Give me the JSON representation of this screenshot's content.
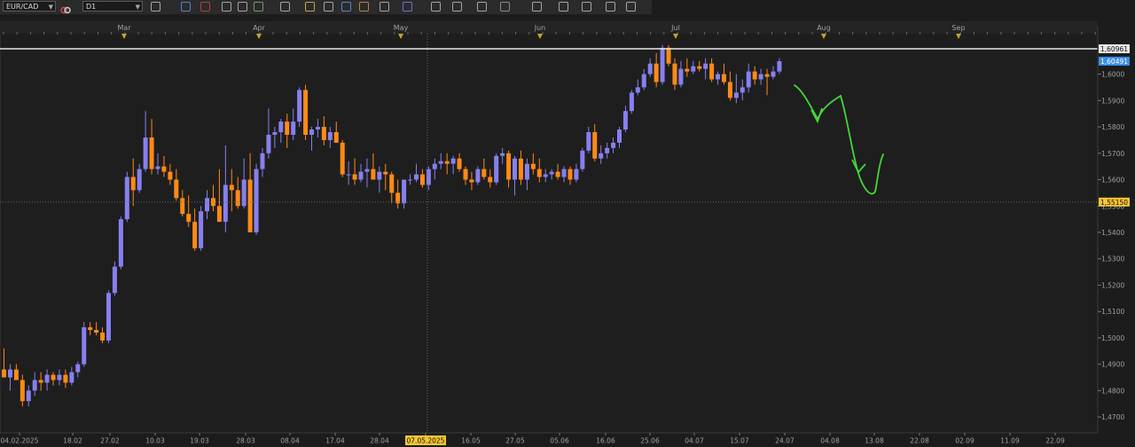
{
  "toolbar": {
    "symbol": "EUR/CAD",
    "timeframe": "D1",
    "icons": [
      "link-icon",
      "chart-type-icon",
      "bar-chart-icon",
      "candle-chart-icon",
      "zoom-in-icon",
      "zoom-out-icon",
      "crosshair-icon",
      "cursor-icon",
      "text-icon",
      "note-icon",
      "palette-icon",
      "globe-icon",
      "pencil-icon",
      "indicator-icon",
      "line-tool-icon",
      "fibonacci-icon",
      "shapes-icon",
      "arrow-icon",
      "sphere-icon",
      "gear-icon",
      "eraser-icon",
      "expand-icon"
    ]
  },
  "colors": {
    "background": "#1c1c1c",
    "up_candle": "#8680f0",
    "down_candle": "#ff8a16",
    "axis_text": "#a0a0a0",
    "highlight_tag": "#f7c531",
    "annotation": "#43d63a",
    "price_line": "#e8e8e8"
  },
  "chart_data": {
    "type": "candlestick",
    "symbol": "EUR/CAD",
    "timeframe": "D1",
    "y_ticks": [
      "1,6000",
      "1,5900",
      "1,5800",
      "1,5700",
      "1,5600",
      "1,5500",
      "1,5400",
      "1,5300",
      "1,5200",
      "1,5100",
      "1,5000",
      "1,4900",
      "1,4800",
      "1,4700"
    ],
    "x_ticks": [
      "04.02.2025",
      "18.02",
      "27.02",
      "10.03",
      "19.03",
      "28.03",
      "08.04",
      "17.04",
      "28.04",
      "07.05.2025",
      "16.05",
      "27.05",
      "05.06",
      "16.06",
      "25.06",
      "04.07",
      "15.07",
      "24.07",
      "04.08",
      "13.08",
      "22.08",
      "02.09",
      "11.09",
      "22.09"
    ],
    "month_labels": [
      "Mar",
      "Apr",
      "May",
      "Jun",
      "Jul",
      "Aug",
      "Sep"
    ],
    "highlighted_date": "07.05.2025",
    "price_labels": {
      "horizontal_line": "1,60961",
      "current": "1,60491",
      "crosshair": "1,55150"
    },
    "ylim": [
      1.464,
      1.616
    ],
    "candles": [
      [
        1.488,
        1.496,
        1.485,
        1.485
      ],
      [
        1.485,
        1.49,
        1.48,
        1.488
      ],
      [
        1.488,
        1.49,
        1.484,
        1.484
      ],
      [
        1.484,
        1.486,
        1.474,
        1.476
      ],
      [
        1.476,
        1.482,
        1.474,
        1.48
      ],
      [
        1.48,
        1.487,
        1.478,
        1.484
      ],
      [
        1.484,
        1.487,
        1.48,
        1.483
      ],
      [
        1.483,
        1.488,
        1.48,
        1.486
      ],
      [
        1.486,
        1.487,
        1.482,
        1.484
      ],
      [
        1.484,
        1.488,
        1.482,
        1.486
      ],
      [
        1.486,
        1.488,
        1.481,
        1.483
      ],
      [
        1.483,
        1.489,
        1.482,
        1.487
      ],
      [
        1.487,
        1.491,
        1.485,
        1.49
      ],
      [
        1.49,
        1.506,
        1.489,
        1.504
      ],
      [
        1.504,
        1.506,
        1.501,
        1.503
      ],
      [
        1.503,
        1.506,
        1.501,
        1.502
      ],
      [
        1.502,
        1.504,
        1.498,
        1.499
      ],
      [
        1.499,
        1.518,
        1.498,
        1.517
      ],
      [
        1.517,
        1.529,
        1.516,
        1.527
      ],
      [
        1.527,
        1.546,
        1.526,
        1.545
      ],
      [
        1.545,
        1.563,
        1.544,
        1.561
      ],
      [
        1.561,
        1.568,
        1.55,
        1.556
      ],
      [
        1.556,
        1.566,
        1.555,
        1.564
      ],
      [
        1.564,
        1.586,
        1.563,
        1.576
      ],
      [
        1.576,
        1.583,
        1.562,
        1.564
      ],
      [
        1.564,
        1.57,
        1.562,
        1.565
      ],
      [
        1.565,
        1.569,
        1.561,
        1.563
      ],
      [
        1.563,
        1.566,
        1.558,
        1.56
      ],
      [
        1.56,
        1.564,
        1.552,
        1.553
      ],
      [
        1.553,
        1.556,
        1.546,
        1.547
      ],
      [
        1.547,
        1.554,
        1.542,
        1.544
      ],
      [
        1.544,
        1.549,
        1.533,
        1.534
      ],
      [
        1.534,
        1.55,
        1.533,
        1.548
      ],
      [
        1.548,
        1.556,
        1.545,
        1.553
      ],
      [
        1.553,
        1.558,
        1.548,
        1.55
      ],
      [
        1.55,
        1.564,
        1.544,
        1.544
      ],
      [
        1.544,
        1.573,
        1.54,
        1.558
      ],
      [
        1.558,
        1.564,
        1.548,
        1.556
      ],
      [
        1.556,
        1.561,
        1.549,
        1.55
      ],
      [
        1.55,
        1.568,
        1.549,
        1.56
      ],
      [
        1.56,
        1.57,
        1.542,
        1.54
      ],
      [
        1.54,
        1.566,
        1.539,
        1.564
      ],
      [
        1.564,
        1.572,
        1.561,
        1.57
      ],
      [
        1.57,
        1.587,
        1.568,
        1.577
      ],
      [
        1.577,
        1.58,
        1.572,
        1.578
      ],
      [
        1.578,
        1.583,
        1.574,
        1.582
      ],
      [
        1.582,
        1.585,
        1.572,
        1.577
      ],
      [
        1.577,
        1.587,
        1.575,
        1.582
      ],
      [
        1.582,
        1.595,
        1.58,
        1.594
      ],
      [
        1.594,
        1.596,
        1.575,
        1.577
      ],
      [
        1.577,
        1.58,
        1.571,
        1.579
      ],
      [
        1.579,
        1.583,
        1.576,
        1.58
      ],
      [
        1.58,
        1.584,
        1.573,
        1.575
      ],
      [
        1.575,
        1.58,
        1.572,
        1.578
      ],
      [
        1.578,
        1.582,
        1.574,
        1.574
      ],
      [
        1.574,
        1.575,
        1.561,
        1.562
      ],
      [
        1.562,
        1.567,
        1.558,
        1.562
      ],
      [
        1.562,
        1.568,
        1.558,
        1.56
      ],
      [
        1.56,
        1.566,
        1.559,
        1.563
      ],
      [
        1.563,
        1.568,
        1.557,
        1.564
      ],
      [
        1.564,
        1.57,
        1.561,
        1.56
      ],
      [
        1.56,
        1.565,
        1.555,
        1.563
      ],
      [
        1.563,
        1.566,
        1.556,
        1.562
      ],
      [
        1.562,
        1.563,
        1.551,
        1.555
      ],
      [
        1.555,
        1.56,
        1.549,
        1.551
      ],
      [
        1.551,
        1.56,
        1.549,
        1.56
      ],
      [
        1.56,
        1.562,
        1.558,
        1.56
      ],
      [
        1.56,
        1.566,
        1.559,
        1.562
      ],
      [
        1.562,
        1.564,
        1.557,
        1.558
      ],
      [
        1.558,
        1.565,
        1.556,
        1.564
      ],
      [
        1.564,
        1.568,
        1.56,
        1.566
      ],
      [
        1.566,
        1.57,
        1.564,
        1.567
      ],
      [
        1.567,
        1.57,
        1.562,
        1.566
      ],
      [
        1.566,
        1.569,
        1.562,
        1.568
      ],
      [
        1.568,
        1.57,
        1.563,
        1.564
      ],
      [
        1.564,
        1.565,
        1.558,
        1.56
      ],
      [
        1.56,
        1.563,
        1.556,
        1.559
      ],
      [
        1.559,
        1.565,
        1.558,
        1.564
      ],
      [
        1.564,
        1.568,
        1.56,
        1.561
      ],
      [
        1.561,
        1.564,
        1.557,
        1.559
      ],
      [
        1.559,
        1.57,
        1.558,
        1.569
      ],
      [
        1.569,
        1.572,
        1.566,
        1.57
      ],
      [
        1.57,
        1.571,
        1.557,
        1.56
      ],
      [
        1.56,
        1.569,
        1.554,
        1.568
      ],
      [
        1.568,
        1.571,
        1.558,
        1.56
      ],
      [
        1.56,
        1.568,
        1.556,
        1.566
      ],
      [
        1.566,
        1.57,
        1.562,
        1.564
      ],
      [
        1.564,
        1.568,
        1.559,
        1.561
      ],
      [
        1.561,
        1.564,
        1.559,
        1.562
      ],
      [
        1.562,
        1.564,
        1.56,
        1.563
      ],
      [
        1.563,
        1.566,
        1.56,
        1.561
      ],
      [
        1.561,
        1.565,
        1.559,
        1.564
      ],
      [
        1.564,
        1.565,
        1.558,
        1.56
      ],
      [
        1.56,
        1.566,
        1.559,
        1.564
      ],
      [
        1.564,
        1.572,
        1.563,
        1.571
      ],
      [
        1.571,
        1.58,
        1.57,
        1.578
      ],
      [
        1.578,
        1.581,
        1.567,
        1.568
      ],
      [
        1.568,
        1.573,
        1.566,
        1.57
      ],
      [
        1.57,
        1.574,
        1.568,
        1.572
      ],
      [
        1.572,
        1.576,
        1.57,
        1.574
      ],
      [
        1.574,
        1.58,
        1.572,
        1.579
      ],
      [
        1.579,
        1.588,
        1.578,
        1.586
      ],
      [
        1.586,
        1.594,
        1.585,
        1.593
      ],
      [
        1.593,
        1.598,
        1.592,
        1.595
      ],
      [
        1.595,
        1.602,
        1.594,
        1.6
      ],
      [
        1.6,
        1.606,
        1.599,
        1.604
      ],
      [
        1.604,
        1.608,
        1.595,
        1.597
      ],
      [
        1.597,
        1.611,
        1.596,
        1.61
      ],
      [
        1.61,
        1.611,
        1.603,
        1.604
      ],
      [
        1.604,
        1.606,
        1.594,
        1.596
      ],
      [
        1.596,
        1.605,
        1.595,
        1.602
      ],
      [
        1.602,
        1.606,
        1.599,
        1.601
      ],
      [
        1.601,
        1.605,
        1.6,
        1.603
      ],
      [
        1.603,
        1.605,
        1.601,
        1.602
      ],
      [
        1.602,
        1.606,
        1.598,
        1.604
      ],
      [
        1.604,
        1.606,
        1.597,
        1.598
      ],
      [
        1.598,
        1.601,
        1.596,
        1.6
      ],
      [
        1.6,
        1.604,
        1.596,
        1.597
      ],
      [
        1.597,
        1.601,
        1.59,
        1.591
      ],
      [
        1.591,
        1.6,
        1.589,
        1.593
      ],
      [
        1.593,
        1.598,
        1.59,
        1.595
      ],
      [
        1.595,
        1.604,
        1.593,
        1.601
      ],
      [
        1.601,
        1.603,
        1.596,
        1.598
      ],
      [
        1.598,
        1.602,
        1.596,
        1.6
      ],
      [
        1.6,
        1.602,
        1.592,
        1.599
      ],
      [
        1.599,
        1.603,
        1.598,
        1.601
      ],
      [
        1.601,
        1.606,
        1.6,
        1.6049
      ]
    ]
  }
}
